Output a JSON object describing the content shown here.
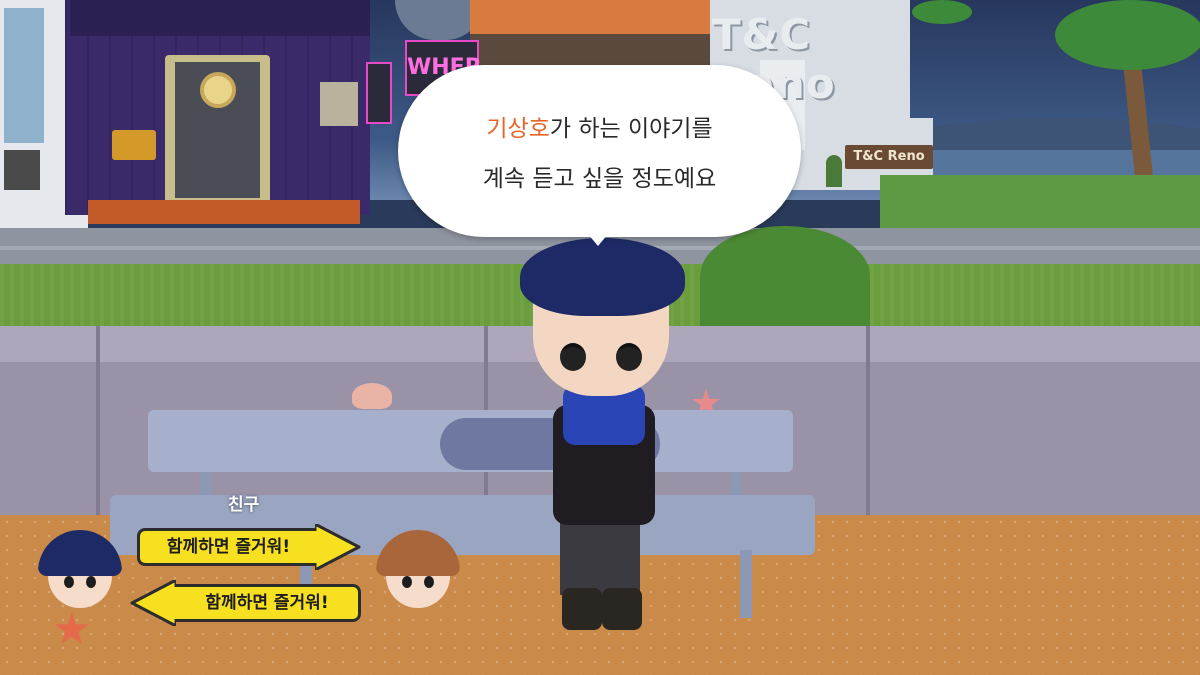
{
  "dialogue": {
    "speaker_name": "기상호",
    "line1_rest": "가 하는 이야기를",
    "line2": "계속 듣고 싶을 정도예요"
  },
  "signs": {
    "shop_big": "T&C Reno",
    "shop_small": "T&C Reno",
    "neon": "WHER"
  },
  "friend_panel": {
    "label": "친구",
    "arrow_right_text": "함께하면 즐거워!",
    "arrow_left_text": "함께하면 즐거워!"
  },
  "colors": {
    "speaker_highlight": "#e8652a",
    "arrow_fill": "#f7e020"
  }
}
